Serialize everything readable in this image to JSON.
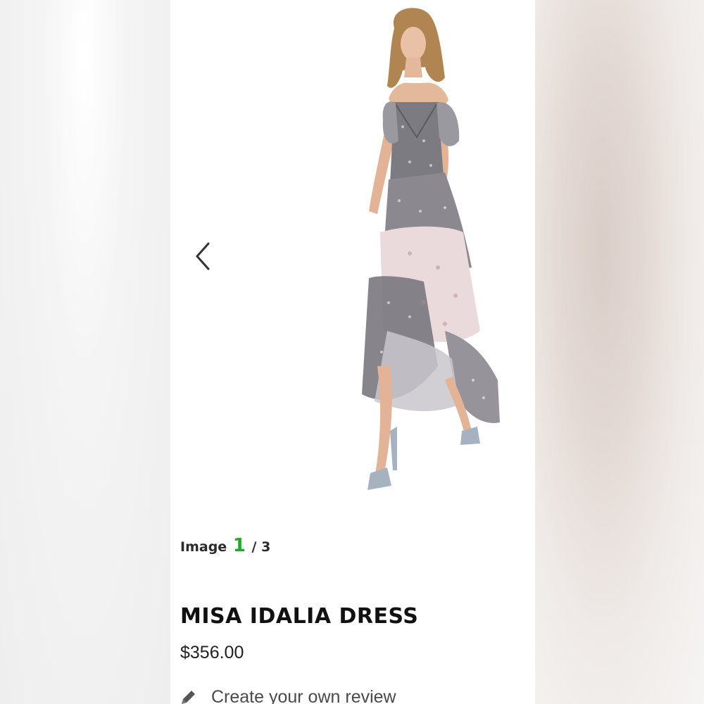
{
  "gallery": {
    "image_label": "Image",
    "current": "1",
    "separator_total": "/ 3",
    "prev_icon": "chevron-left-icon"
  },
  "product": {
    "title": "MISA IDALIA DRESS",
    "price": "$356.00"
  },
  "review": {
    "link_text": "Create your own review",
    "icon": "pencil-icon"
  },
  "colors": {
    "counter_accent": "#2aa52f",
    "title": "#111111",
    "text": "#222222"
  }
}
